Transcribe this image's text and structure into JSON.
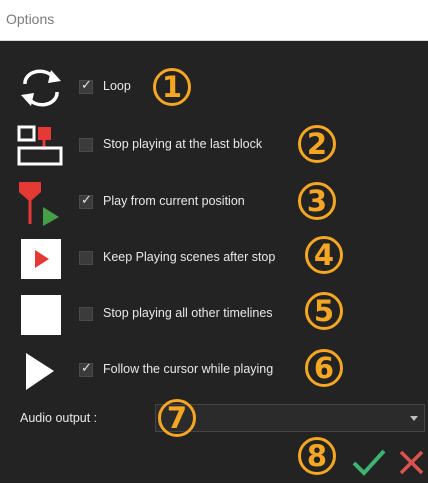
{
  "window": {
    "title": "Options"
  },
  "options": [
    {
      "label": "Loop",
      "checked": true,
      "icon": "loop-icon",
      "badge": "1"
    },
    {
      "label": "Stop playing at the last block",
      "checked": false,
      "icon": "stop-at-last-block-icon",
      "badge": "2"
    },
    {
      "label": "Play from current position",
      "checked": true,
      "icon": "play-from-position-icon",
      "badge": "3"
    },
    {
      "label": "Keep Playing scenes after stop",
      "checked": false,
      "icon": "keep-playing-icon",
      "badge": "4"
    },
    {
      "label": "Stop playing all other timelines",
      "checked": false,
      "icon": "stop-square-icon",
      "badge": "5"
    },
    {
      "label": "Follow the cursor while playing",
      "checked": true,
      "icon": "play-triangle-icon",
      "badge": "6"
    }
  ],
  "audio": {
    "label": "Audio output :",
    "value": "",
    "badge": "7"
  },
  "actions": {
    "badge": "8",
    "ok_icon": "checkmark-icon",
    "cancel_icon": "close-icon"
  },
  "colors": {
    "accent": "#f5a623",
    "ok": "#3cb371",
    "cancel": "#d9534f",
    "icon_red": "#e53935",
    "icon_green": "#43a047"
  }
}
